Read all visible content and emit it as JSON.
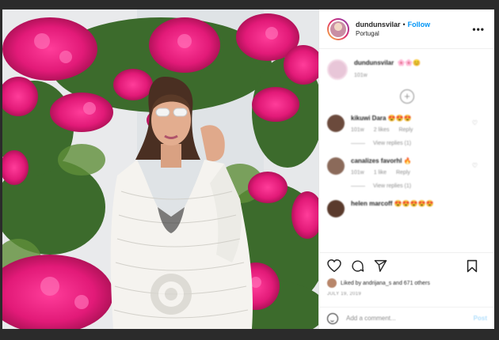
{
  "post": {
    "username": "dundunsvilar",
    "dot": "•",
    "follow_label": "Follow",
    "location": "Portugal",
    "more_label": "•••"
  },
  "caption": {
    "username": "dundunsvilar",
    "emoji": "🌸🌸😊",
    "time": "101w"
  },
  "load_more_label": "+",
  "comments": [
    {
      "username": "kikuwi Dara",
      "emoji": "😍😍😍",
      "time": "101w",
      "likes": "2 likes",
      "reply": "Reply",
      "replies": "View replies (1)",
      "avatar_color": "#6b4a3c"
    },
    {
      "username": "canalizes favorhl",
      "emoji": "🔥",
      "time": "101w",
      "likes": "1 like",
      "reply": "Reply",
      "replies": "View replies (1)",
      "avatar_color": "#8b6a5a"
    },
    {
      "username": "helen marcoff",
      "emoji": "😍😍😍😍😍",
      "avatar_color": "#5a3a2c"
    }
  ],
  "likes": {
    "text": "Liked by andrijana_s and 671 others"
  },
  "date": "JULY 19, 2019",
  "add_comment": {
    "placeholder": "Add a comment...",
    "post_label": "Post"
  },
  "icons": [
    "heart-icon",
    "comment-icon",
    "share-icon",
    "bookmark-icon",
    "smile-icon",
    "more-icon"
  ]
}
